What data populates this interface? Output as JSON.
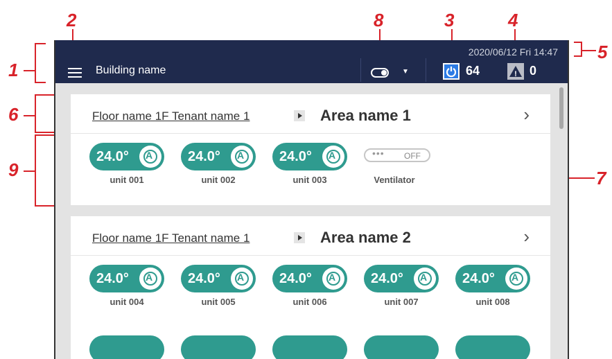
{
  "callouts": [
    "1",
    "2",
    "3",
    "4",
    "5",
    "6",
    "7",
    "8",
    "9"
  ],
  "header": {
    "building_name": "Building name",
    "datetime": "2020/06/12 Fri 14:47",
    "power_count": "64",
    "warning_count": "0",
    "menu_icon": "hamburger-icon",
    "mode_icon": "toggle-icon",
    "power_icon": "power-icon",
    "warning_icon": "warning-icon"
  },
  "areas": [
    {
      "floor_tenant": "Floor name 1F Tenant name 1",
      "area_name": "Area name 1",
      "units": [
        {
          "temp": "24.0",
          "label": "unit 001"
        },
        {
          "temp": "24.0",
          "label": "unit 002"
        },
        {
          "temp": "24.0",
          "label": "unit 003"
        }
      ],
      "ventilator": {
        "state": "OFF",
        "label": "Ventilator"
      }
    },
    {
      "floor_tenant": "Floor name 1F Tenant name 1",
      "area_name": "Area name 2",
      "units": [
        {
          "temp": "24.0",
          "label": "unit 004"
        },
        {
          "temp": "24.0",
          "label": "unit 005"
        },
        {
          "temp": "24.0",
          "label": "unit 006"
        },
        {
          "temp": "24.0",
          "label": "unit 007"
        },
        {
          "temp": "24.0",
          "label": "unit 008"
        }
      ]
    }
  ],
  "colors": {
    "topbar": "#1f2a4d",
    "unit_on": "#2f9b8f",
    "callout": "#d8232a",
    "power": "#2c7be5"
  }
}
